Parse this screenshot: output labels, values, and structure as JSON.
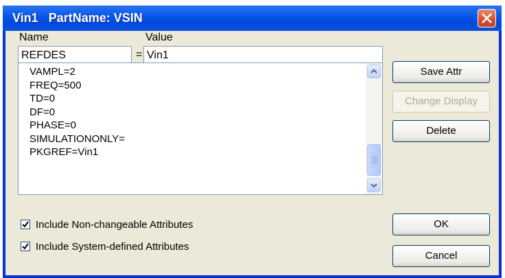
{
  "titlebar": {
    "title": "Vin1   PartName: VSIN"
  },
  "form": {
    "name_label": "Name",
    "value_label": "Value",
    "name_value": "REFDES",
    "equals": "=",
    "value_value": "Vin1"
  },
  "attributes": [
    "VAMPL=2",
    "FREQ=500",
    "TD=0",
    "DF=0",
    "PHASE=0",
    "SIMULATIONONLY=",
    "PKGREF=Vin1"
  ],
  "buttons": {
    "save_attr": "Save Attr",
    "change_display": "Change Display",
    "delete": "Delete",
    "ok": "OK",
    "cancel": "Cancel"
  },
  "options": {
    "include_nonchangeable": "Include Non-changeable Attributes",
    "include_nonchangeable_checked": true,
    "include_system_defined": "Include System-defined Attributes",
    "include_system_defined_checked": true
  },
  "colors": {
    "titlebar": "#0a58e6",
    "dialog_face": "#ece9d8",
    "close_button": "#d4502c"
  }
}
